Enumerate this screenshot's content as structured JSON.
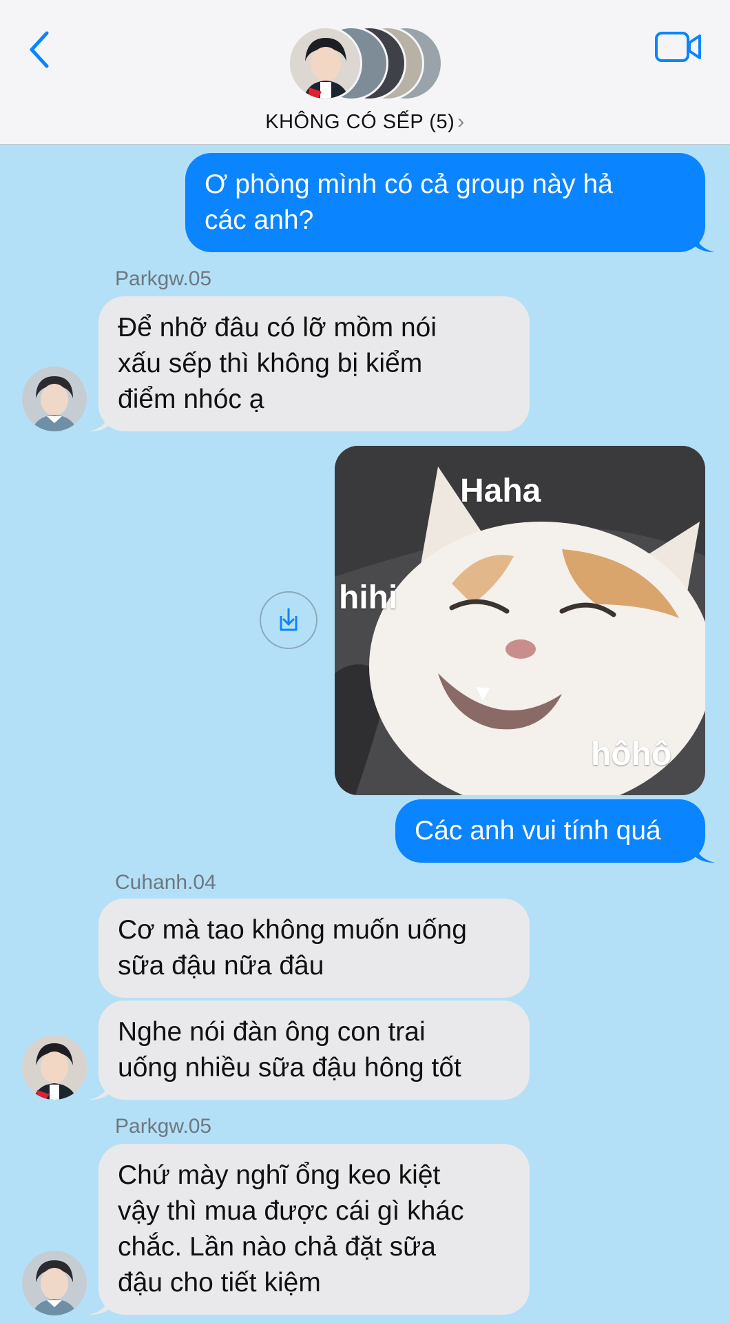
{
  "header": {
    "group_title": "KHÔNG CÓ SẾP (5)",
    "back_icon": "chevron-left-icon",
    "video_icon": "video-camera-icon",
    "accent_color": "#0a84ff"
  },
  "messages": [
    {
      "from": "me",
      "text_lines": [
        "Ơ phòng mình có cả group này hả",
        "các anh?"
      ]
    },
    {
      "sender": "Parkgw.05",
      "text_lines": [
        "Để nhỡ đâu có lỡ mồm nói",
        "xấu sếp thì không bị kiểm",
        "điểm nhóc ạ"
      ]
    },
    {
      "from": "me",
      "type": "image",
      "image_words": [
        "Haha",
        "hihi",
        "hôhô"
      ],
      "save_icon": "download-icon"
    },
    {
      "from": "me",
      "text_lines": [
        "Các anh vui tính quá"
      ]
    },
    {
      "sender": "Cuhanh.04",
      "text_lines": [
        "Cơ mà tao không muốn uống",
        "sữa đậu nữa đâu"
      ]
    },
    {
      "text_lines": [
        "Nghe nói đàn ông con trai",
        "uống nhiều sữa đậu hông tốt"
      ]
    },
    {
      "sender": "Parkgw.05",
      "text_lines": [
        "Chứ mày nghĩ ổng keo kiệt",
        "vậy thì mua được cái gì khác",
        "chắc. Lần nào chả đặt sữa",
        "đậu cho tiết kiệm"
      ]
    }
  ]
}
